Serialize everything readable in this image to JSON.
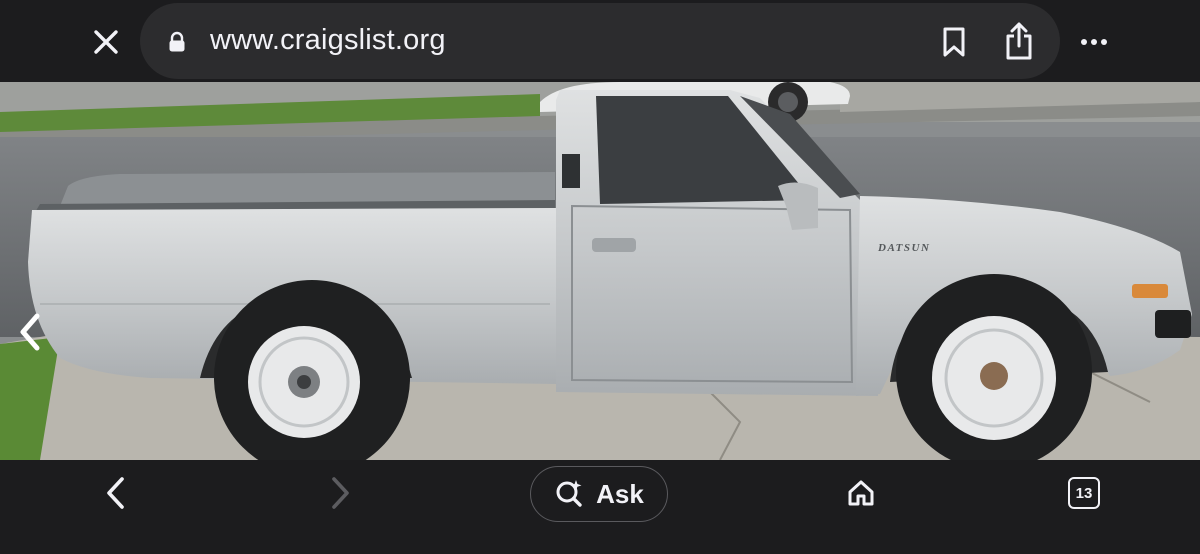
{
  "browser": {
    "url": "www.craigslist.org",
    "tab_count": "13",
    "ask_label": "Ask",
    "icons": {
      "close": "close-icon",
      "lock": "lock-icon",
      "bookmark": "bookmark-icon",
      "share": "share-icon",
      "more": "more-icon",
      "back": "back-icon",
      "forward": "forward-icon",
      "ask": "sparkle-search-icon",
      "home": "home-icon",
      "tabs": "tabs-icon"
    }
  },
  "photo": {
    "badge_text": "DATSUN",
    "colors": {
      "truck": "#c9ccce",
      "road": "#6f7275",
      "grass": "#5e8a3a",
      "sidewalk": "#b8b5ae"
    }
  }
}
